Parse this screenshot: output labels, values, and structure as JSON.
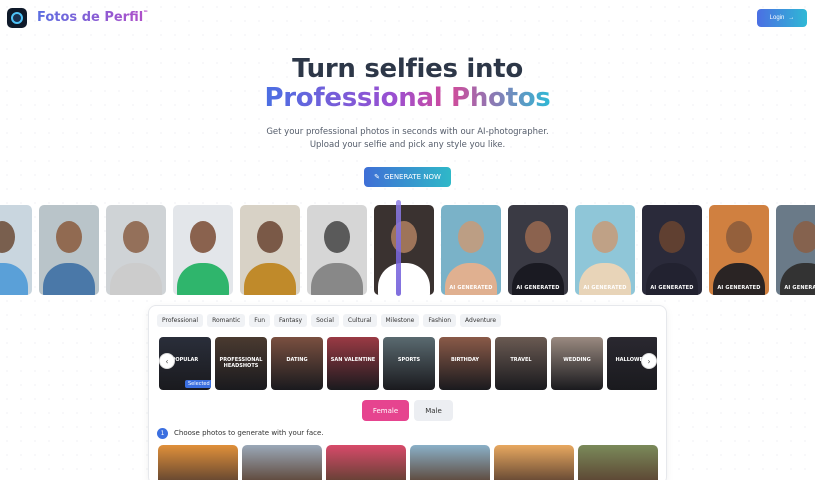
{
  "header": {
    "brand": "Fotos de Perfil",
    "brand_tm": "™",
    "login_label": "Login",
    "login_arrow": "→"
  },
  "hero": {
    "line1": "Turn selfies into",
    "line2": "Professional Photos",
    "sub1": "Get your professional photos in seconds with our AI-photographer.",
    "sub2": "Upload your selfie and pick any style you like.",
    "generate_label": "GENERATE NOW",
    "generate_icon": "✎"
  },
  "strip": {
    "before": [
      {
        "bg": "#c9d6df",
        "skin": "#6b4a35",
        "shirt": "#5aa0d8"
      },
      {
        "bg": "#b9c4c9",
        "skin": "#8a5a3c",
        "shirt": "#4a78a8"
      },
      {
        "bg": "#cfd3d6",
        "skin": "#8a5e44",
        "shirt": "#cccccc"
      },
      {
        "bg": "#e3e6ea",
        "skin": "#7a4a32",
        "shirt": "#2fb56c"
      },
      {
        "bg": "#d8d2c6",
        "skin": "#6a4430",
        "shirt": "#c08a2a"
      },
      {
        "bg": "#d6d6d6",
        "skin": "#444444",
        "shirt": "#888888"
      }
    ],
    "after": [
      {
        "bg": "#3a3230",
        "skin": "#b08060",
        "shirt": "#ffffff",
        "label": "AI GENERATED"
      },
      {
        "bg": "#7ab2c8",
        "skin": "#c89a78",
        "shirt": "#e0b090",
        "label": "AI GENERATED"
      },
      {
        "bg": "#3a3a44",
        "skin": "#9a6a50",
        "shirt": "#1a1a22",
        "label": "AI GENERATED"
      },
      {
        "bg": "#8fc6d8",
        "skin": "#c89a78",
        "shirt": "#e8d4b8",
        "label": "AI GENERATED"
      },
      {
        "bg": "#2a2a3a",
        "skin": "#6a4430",
        "shirt": "#222230",
        "label": "AI GENERATED"
      },
      {
        "bg": "#d08040",
        "skin": "#8a5a3c",
        "shirt": "#2a2424",
        "label": "AI GENERATED"
      },
      {
        "bg": "#6a7a88",
        "skin": "#8a5e44",
        "shirt": "#333333",
        "label": "AI GENERATED"
      }
    ]
  },
  "categories": [
    "Professional",
    "Romantic",
    "Fun",
    "Fantasy",
    "Social",
    "Cultural",
    "Milestone",
    "Fashion",
    "Adventure"
  ],
  "styles": [
    {
      "label": "POPULAR",
      "bg": "#2a2e3a",
      "selected": "Selected"
    },
    {
      "label": "PROFESSIONAL HEADSHOTS",
      "bg": "#4a3a30"
    },
    {
      "label": "DATING",
      "bg": "#7a5040"
    },
    {
      "label": "SAN VALENTINE",
      "bg": "#9a3a44"
    },
    {
      "label": "SPORTS",
      "bg": "#5a6a70"
    },
    {
      "label": "BIRTHDAY",
      "bg": "#8a5a48"
    },
    {
      "label": "TRAVEL",
      "bg": "#6a5a52"
    },
    {
      "label": "WEDDING",
      "bg": "#9a8a80"
    },
    {
      "label": "HALLOWEEN",
      "bg": "#2a2830"
    }
  ],
  "nav": {
    "prev": "‹",
    "next": "›"
  },
  "gender": {
    "female": "Female",
    "male": "Male"
  },
  "step": {
    "number": "1",
    "text": "Choose photos to generate with your face."
  },
  "choose_photos": [
    {
      "bg": "#e0903a"
    },
    {
      "bg": "#9aa8b8"
    },
    {
      "bg": "#d84a6a"
    },
    {
      "bg": "#8ab0c8"
    },
    {
      "bg": "#e8a860"
    },
    {
      "bg": "#7a8a5a"
    }
  ]
}
